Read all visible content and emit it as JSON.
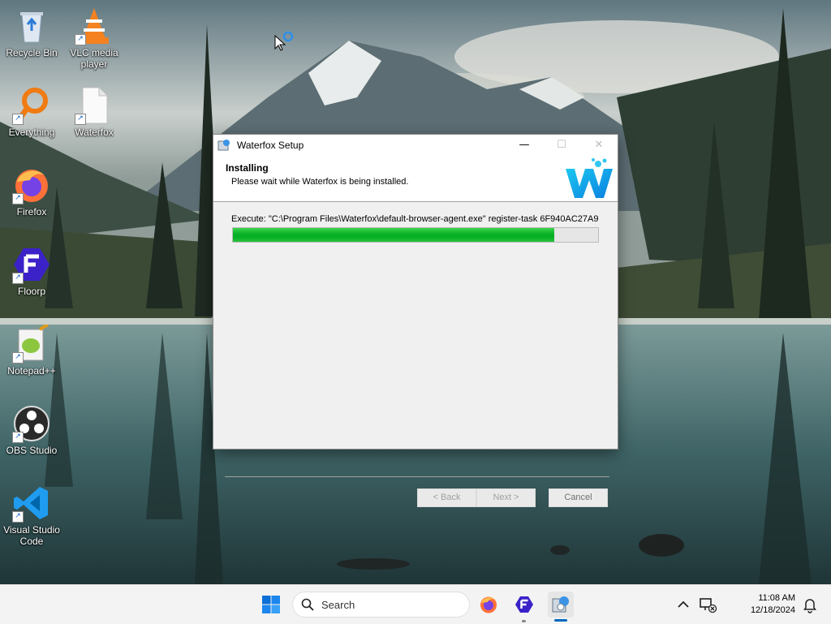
{
  "desktop": {
    "icons": [
      {
        "label": "Recycle Bin",
        "icon": "recycle-bin-icon"
      },
      {
        "label": "VLC media player",
        "icon": "vlc-icon"
      },
      {
        "label": "Everything",
        "icon": "everything-search-icon"
      },
      {
        "label": "Waterfox",
        "icon": "blank-file-icon"
      },
      {
        "label": "Firefox",
        "icon": "firefox-icon"
      },
      {
        "label": "Floorp",
        "icon": "floorp-icon"
      },
      {
        "label": "Notepad++",
        "icon": "notepad-plus-plus-icon"
      },
      {
        "label": "OBS Studio",
        "icon": "obs-icon"
      },
      {
        "label": "Visual Studio Code",
        "icon": "vscode-icon"
      }
    ]
  },
  "window": {
    "title": "Waterfox Setup",
    "header_title": "Installing",
    "header_subtitle": "Please wait while Waterfox is being installed.",
    "status_text": "Execute: \"C:\\Program Files\\Waterfox\\default-browser-agent.exe\" register-task 6F940AC27A9",
    "progress_percent": 88,
    "buttons": {
      "back": "< Back",
      "next": "Next >",
      "cancel": "Cancel"
    },
    "controls": {
      "minimize": "—",
      "maximize": "☐",
      "close": "✕"
    }
  },
  "taskbar": {
    "search_placeholder": "Search",
    "items": [
      "start-icon",
      "firefox-icon",
      "floorp-icon",
      "waterfox-setup-icon"
    ],
    "clock": {
      "time": "11:08 AM",
      "date": "12/18/2024"
    }
  },
  "colors": {
    "progress_green": "#06b025",
    "accent": "#0067c0"
  }
}
